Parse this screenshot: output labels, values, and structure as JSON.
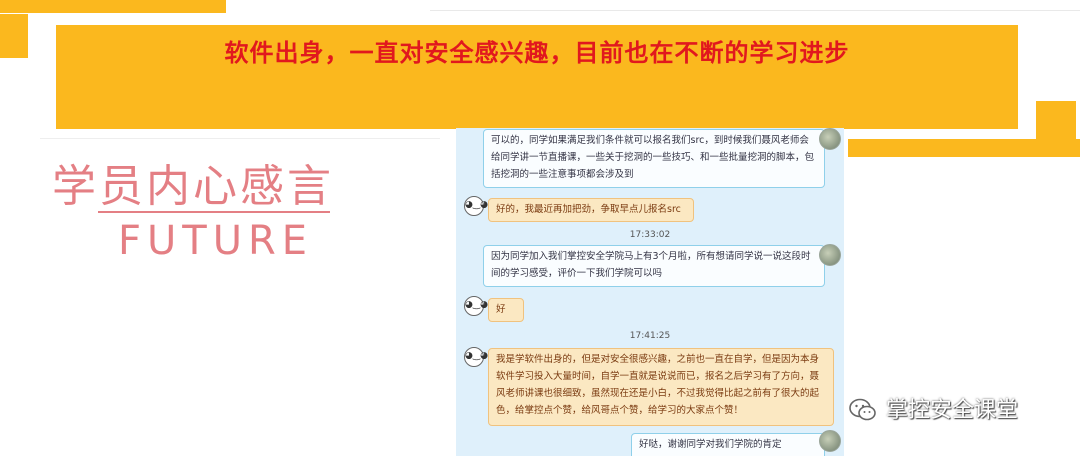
{
  "banner": {
    "title": "软件出身，一直对安全感兴趣，目前也在不断的学习进步"
  },
  "heading": {
    "cn": "学员内心感言",
    "en": "FUTURE"
  },
  "chat": {
    "messages": [
      {
        "text": "可以的，同学如果满足我们条件就可以报名我们src，到时候我们聂风老师会给同学讲一节直播课，一些关于挖洞的一些技巧、和一些批量挖洞的脚本，包括挖洞的一些注意事项都会涉及到"
      },
      {
        "text": "好的，我最近再加把劲，争取早点儿报名src"
      },
      {
        "time": "17:33:02"
      },
      {
        "text": "因为同学加入我们掌控安全学院马上有3个月啦，所有想请同学说一说这段时间的学习感受，评价一下我们学院可以吗"
      },
      {
        "text": "好"
      },
      {
        "time": "17:41:25"
      },
      {
        "text": "我是学软件出身的，但是对安全很感兴趣，之前也一直在自学，但是因为本身软件学习投入大量时间，自学一直就是说说而已，报名之后学习有了方向，聂风老师讲课也很细致，虽然现在还是小白，不过我觉得比起之前有了很大的起色，给掌控点个赞，给风哥点个赞，给学习的大家点个赞！"
      },
      {
        "text": "好哒，谢谢同学对我们学院的肯定"
      }
    ]
  },
  "watermark": {
    "icon": "wechat-icon",
    "text": "掌控安全课堂"
  },
  "colors": {
    "accent": "#fbb81e",
    "title_red": "#e1181e",
    "heading_pink": "#e47f84",
    "chat_bg": "#dff0fb"
  }
}
